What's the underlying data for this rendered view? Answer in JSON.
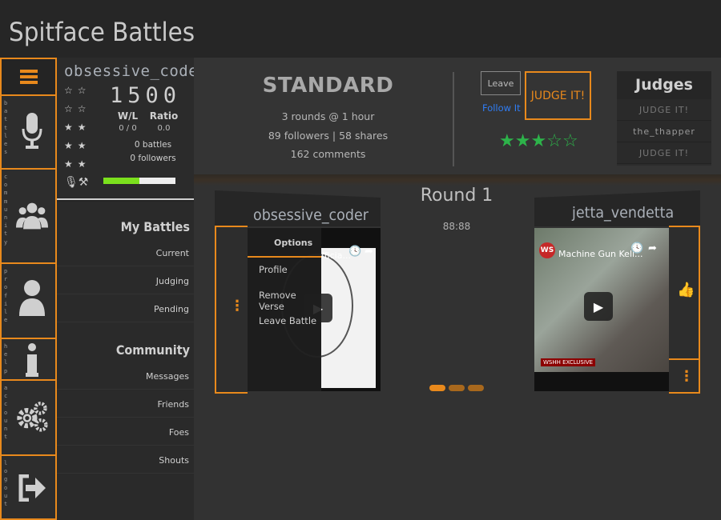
{
  "app": {
    "title": "Spitface Battles"
  },
  "rail": {
    "items": [
      {
        "label": "battles",
        "icon": "microphone-icon"
      },
      {
        "label": "community",
        "icon": "users-icon"
      },
      {
        "label": "profile",
        "icon": "user-icon"
      },
      {
        "label": "help",
        "icon": "info-icon"
      },
      {
        "label": "account",
        "icon": "gears-icon"
      },
      {
        "label": "logout",
        "icon": "sign-out-icon"
      }
    ]
  },
  "profile": {
    "username": "obsessive_coder",
    "score": "1500",
    "wl_label": "W/L",
    "ratio_label": "Ratio",
    "wl_value": "0 / 0",
    "ratio_value": "0.0",
    "battles": "0 battles",
    "followers": "0 followers",
    "progress": 0.5
  },
  "nav": {
    "my_battles": "My Battles",
    "current": "Current",
    "judging": "Judging",
    "pending": "Pending",
    "community": "Community",
    "messages": "Messages",
    "friends": "Friends",
    "foes": "Foes",
    "shouts": "Shouts"
  },
  "battle": {
    "type": "STANDARD",
    "rounds": "3 rounds @ 1 hour",
    "stats": "89 followers | 58 shares",
    "comments": "162 comments",
    "leave": "Leave",
    "follow": "Follow It",
    "judge": "JUDGE IT!",
    "rating": 3,
    "rating_max": 5
  },
  "judges": {
    "title": "Judges",
    "rows": [
      "JUDGE IT!",
      "the_thapper",
      "JUDGE IT!"
    ]
  },
  "round": {
    "title": "Round 1",
    "timer": "88:88"
  },
  "left_card": {
    "name": "obsessive_coder",
    "options_title": "Options",
    "options": [
      "Profile",
      "Remove Verse",
      "Leave Battle"
    ],
    "video_title_fragment": "fficia..."
  },
  "right_card": {
    "name": "jetta_vendetta",
    "video_title": "Machine Gun Kell...",
    "badge": "WSHH EXCLUSIVE"
  },
  "colors": {
    "accent": "#e8891c",
    "star": "#2db34a",
    "link": "#2f7df5"
  }
}
